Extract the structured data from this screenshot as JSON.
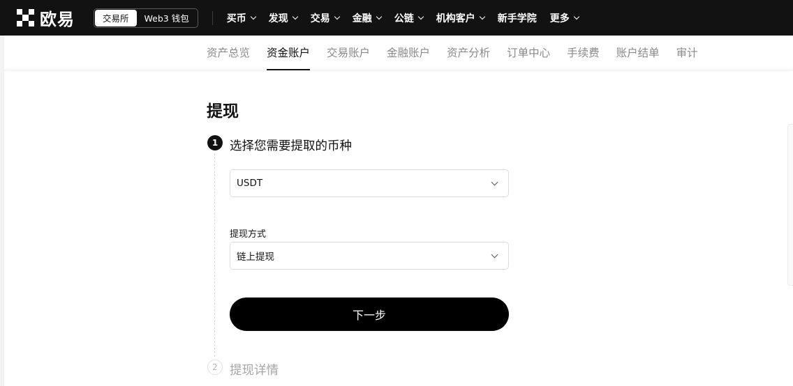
{
  "brand": {
    "logo_text": "欧易",
    "logo_icon": "okx-grid-logo-icon"
  },
  "mode_switch": {
    "exchange_label": "交易所",
    "wallet_label": "Web3 钱包",
    "active": "exchange"
  },
  "top_nav": {
    "items": [
      {
        "label": "买币",
        "has_dropdown": true
      },
      {
        "label": "发现",
        "has_dropdown": true
      },
      {
        "label": "交易",
        "has_dropdown": true
      },
      {
        "label": "金融",
        "has_dropdown": true
      },
      {
        "label": "公链",
        "has_dropdown": true
      },
      {
        "label": "机构客户",
        "has_dropdown": true
      },
      {
        "label": "新手学院",
        "has_dropdown": false
      },
      {
        "label": "更多",
        "has_dropdown": true
      }
    ]
  },
  "sub_nav": {
    "items": [
      {
        "label": "资产总览"
      },
      {
        "label": "资金账户",
        "active": true
      },
      {
        "label": "交易账户"
      },
      {
        "label": "金融账户"
      },
      {
        "label": "资产分析"
      },
      {
        "label": "订单中心"
      },
      {
        "label": "手续费"
      },
      {
        "label": "账户结单"
      },
      {
        "label": "审计"
      }
    ]
  },
  "page": {
    "title": "提现"
  },
  "steps": [
    {
      "number": "1",
      "title": "选择您需要提取的币种",
      "state": "active"
    },
    {
      "number": "2",
      "title": "提现详情",
      "state": "pending"
    }
  ],
  "coin_select": {
    "value": "USDT"
  },
  "method_field": {
    "label": "提现方式",
    "value": "链上提现"
  },
  "next_button": {
    "label": "下一步"
  },
  "colors": {
    "topbar_bg": "#121212",
    "primary_button": "#000000",
    "inactive_text": "#8a8a8a"
  }
}
